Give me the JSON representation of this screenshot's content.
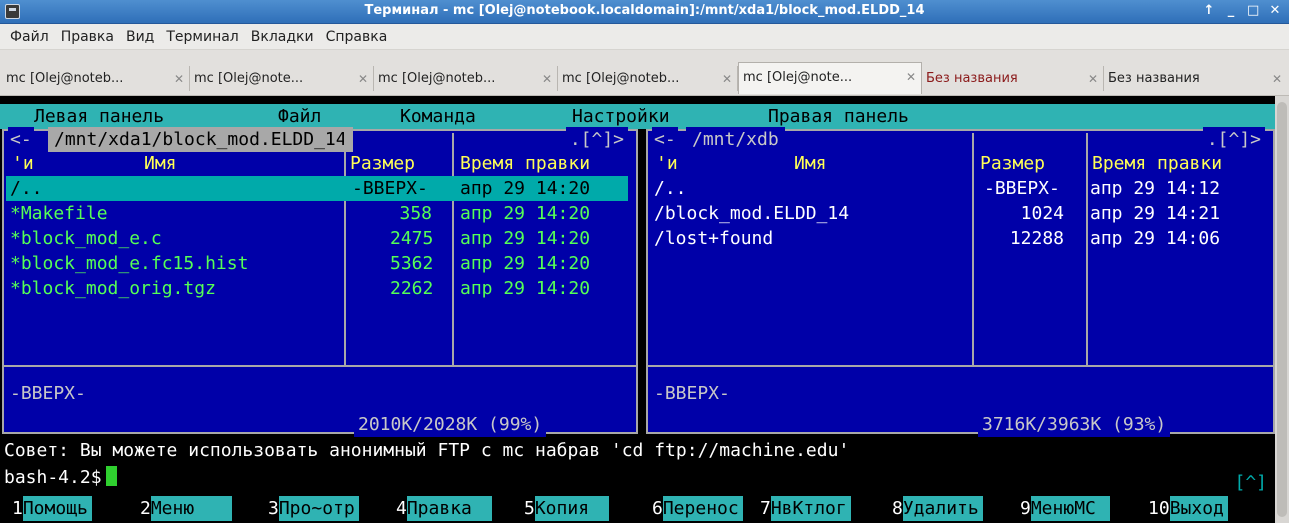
{
  "window": {
    "title": "Терминал - mc [Olej@notebook.localdomain]:/mnt/xda1/block_mod.ELDD_14",
    "controls": [
      "↑",
      "_",
      "□",
      "✕"
    ]
  },
  "menubar": [
    "Файл",
    "Правка",
    "Вид",
    "Терминал",
    "Вкладки",
    "Справка"
  ],
  "tabs": [
    {
      "label": "mc [Olej@noteb...",
      "close": "✕"
    },
    {
      "label": "mc [Olej@note...",
      "close": "✕"
    },
    {
      "label": "mc [Olej@noteb...",
      "close": "✕"
    },
    {
      "label": "mc [Olej@noteb...",
      "close": "✕"
    },
    {
      "label": "mc [Olej@note...",
      "close": "✕"
    },
    {
      "label": "Без названия",
      "close": "✕"
    },
    {
      "label": "Без названия",
      "close": "✕"
    }
  ],
  "mc_menu": [
    "Левая панель",
    "Файл",
    "Команда",
    "Настройки",
    "Правая панель"
  ],
  "left_panel": {
    "path": "/mnt/xda1/block_mod.ELDD_14",
    "left_corner": "<-",
    "right_corner": ".[^]>",
    "headers": {
      "flag": "'и",
      "name": "Имя",
      "size": "Размер",
      "time": "Время правки"
    },
    "rows": [
      {
        "name": "/..",
        "size": "-ВВЕРХ-",
        "time": "апр 29 14:20",
        "selected": true
      },
      {
        "name": "*Makefile",
        "size": "358",
        "time": "апр 29 14:20"
      },
      {
        "name": "*block_mod_e.c",
        "size": "2475",
        "time": "апр 29 14:20"
      },
      {
        "name": "*block_mod_e.fc15.hist",
        "size": "5362",
        "time": "апр 29 14:20"
      },
      {
        "name": "*block_mod_orig.tgz",
        "size": "2262",
        "time": "апр 29 14:20"
      }
    ],
    "info": "-ВВЕРХ-",
    "footer": "2010K/2028K (99%)"
  },
  "right_panel": {
    "path": "/mnt/xdb",
    "left_corner": "<-",
    "right_corner": ".[^]>",
    "headers": {
      "flag": "'и",
      "name": "Имя",
      "size": "Размер",
      "time": "Время правки"
    },
    "rows": [
      {
        "name": "/..",
        "size": "-ВВЕРХ-",
        "time": "апр 29 14:12"
      },
      {
        "name": "/block_mod.ELDD_14",
        "size": "1024",
        "time": "апр 29 14:21"
      },
      {
        "name": "/lost+found",
        "size": "12288",
        "time": "апр 29 14:06"
      }
    ],
    "info": "-ВВЕРХ-",
    "footer": "3716K/3963K (93%)"
  },
  "hint": "Совет: Вы можете использовать анонимный FTP с mc набрав 'cd ftp://machine.edu'",
  "prompt": "bash-4.2$",
  "history_button": "[^]",
  "fkeys": [
    {
      "n": "1",
      "label": "Помощь"
    },
    {
      "n": "2",
      "label": "Меню"
    },
    {
      "n": "3",
      "label": "Про~отр"
    },
    {
      "n": "4",
      "label": "Правка"
    },
    {
      "n": "5",
      "label": "Копия"
    },
    {
      "n": "6",
      "label": "Перенос"
    },
    {
      "n": "7",
      "label": "НвКтлог"
    },
    {
      "n": "8",
      "label": "Удалить"
    },
    {
      "n": "9",
      "label": "МенюMC"
    },
    {
      "n": "10",
      "label": "Выход"
    }
  ],
  "colors": {
    "panel_bg": "#0000a8",
    "menu_bg": "#2fb3b3",
    "file_green": "#55ff55",
    "header_yellow": "#ffff55"
  }
}
